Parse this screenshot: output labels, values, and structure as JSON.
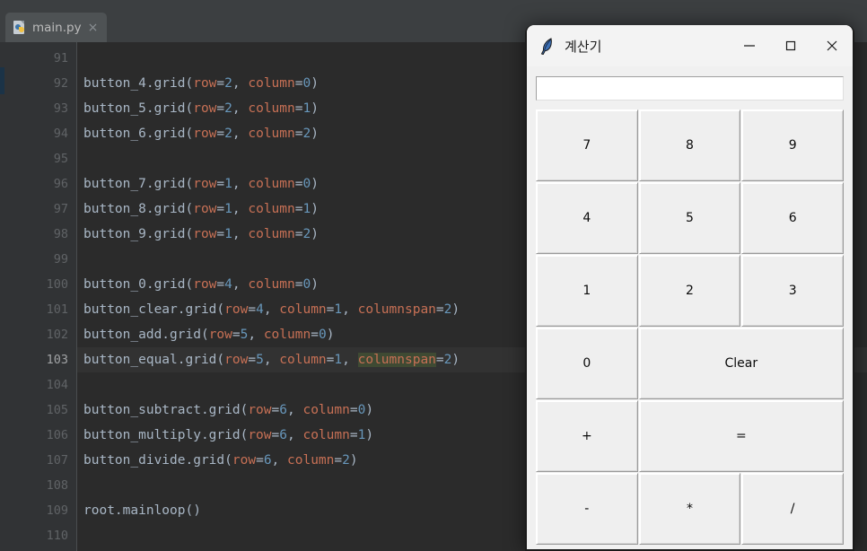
{
  "ide": {
    "tab": {
      "icon": "python-file-icon",
      "label": "main.py",
      "close": "×"
    },
    "editor": {
      "current_line": 103,
      "highlighted_identifier": "columnspan",
      "lines": [
        {
          "no": "91",
          "segments": []
        },
        {
          "no": "92",
          "segments": [
            {
              "t": "button_4.grid(",
              "c": "plain"
            },
            {
              "t": "row",
              "c": "kw"
            },
            {
              "t": "=",
              "c": "plain"
            },
            {
              "t": "2",
              "c": "num"
            },
            {
              "t": ", ",
              "c": "plain"
            },
            {
              "t": "column",
              "c": "kw"
            },
            {
              "t": "=",
              "c": "plain"
            },
            {
              "t": "0",
              "c": "num"
            },
            {
              "t": ")",
              "c": "plain"
            }
          ]
        },
        {
          "no": "93",
          "segments": [
            {
              "t": "button_5.grid(",
              "c": "plain"
            },
            {
              "t": "row",
              "c": "kw"
            },
            {
              "t": "=",
              "c": "plain"
            },
            {
              "t": "2",
              "c": "num"
            },
            {
              "t": ", ",
              "c": "plain"
            },
            {
              "t": "column",
              "c": "kw"
            },
            {
              "t": "=",
              "c": "plain"
            },
            {
              "t": "1",
              "c": "num"
            },
            {
              "t": ")",
              "c": "plain"
            }
          ]
        },
        {
          "no": "94",
          "segments": [
            {
              "t": "button_6.grid(",
              "c": "plain"
            },
            {
              "t": "row",
              "c": "kw"
            },
            {
              "t": "=",
              "c": "plain"
            },
            {
              "t": "2",
              "c": "num"
            },
            {
              "t": ", ",
              "c": "plain"
            },
            {
              "t": "column",
              "c": "kw"
            },
            {
              "t": "=",
              "c": "plain"
            },
            {
              "t": "2",
              "c": "num"
            },
            {
              "t": ")",
              "c": "plain"
            }
          ]
        },
        {
          "no": "95",
          "segments": []
        },
        {
          "no": "96",
          "segments": [
            {
              "t": "button_7.grid(",
              "c": "plain"
            },
            {
              "t": "row",
              "c": "kw"
            },
            {
              "t": "=",
              "c": "plain"
            },
            {
              "t": "1",
              "c": "num"
            },
            {
              "t": ", ",
              "c": "plain"
            },
            {
              "t": "column",
              "c": "kw"
            },
            {
              "t": "=",
              "c": "plain"
            },
            {
              "t": "0",
              "c": "num"
            },
            {
              "t": ")",
              "c": "plain"
            }
          ]
        },
        {
          "no": "97",
          "segments": [
            {
              "t": "button_8.grid(",
              "c": "plain"
            },
            {
              "t": "row",
              "c": "kw"
            },
            {
              "t": "=",
              "c": "plain"
            },
            {
              "t": "1",
              "c": "num"
            },
            {
              "t": ", ",
              "c": "plain"
            },
            {
              "t": "column",
              "c": "kw"
            },
            {
              "t": "=",
              "c": "plain"
            },
            {
              "t": "1",
              "c": "num"
            },
            {
              "t": ")",
              "c": "plain"
            }
          ]
        },
        {
          "no": "98",
          "segments": [
            {
              "t": "button_9.grid(",
              "c": "plain"
            },
            {
              "t": "row",
              "c": "kw"
            },
            {
              "t": "=",
              "c": "plain"
            },
            {
              "t": "1",
              "c": "num"
            },
            {
              "t": ", ",
              "c": "plain"
            },
            {
              "t": "column",
              "c": "kw"
            },
            {
              "t": "=",
              "c": "plain"
            },
            {
              "t": "2",
              "c": "num"
            },
            {
              "t": ")",
              "c": "plain"
            }
          ]
        },
        {
          "no": "99",
          "segments": []
        },
        {
          "no": "100",
          "segments": [
            {
              "t": "button_0.grid(",
              "c": "plain"
            },
            {
              "t": "row",
              "c": "kw"
            },
            {
              "t": "=",
              "c": "plain"
            },
            {
              "t": "4",
              "c": "num"
            },
            {
              "t": ", ",
              "c": "plain"
            },
            {
              "t": "column",
              "c": "kw"
            },
            {
              "t": "=",
              "c": "plain"
            },
            {
              "t": "0",
              "c": "num"
            },
            {
              "t": ")",
              "c": "plain"
            }
          ]
        },
        {
          "no": "101",
          "segments": [
            {
              "t": "button_clear.grid(",
              "c": "plain"
            },
            {
              "t": "row",
              "c": "kw"
            },
            {
              "t": "=",
              "c": "plain"
            },
            {
              "t": "4",
              "c": "num"
            },
            {
              "t": ", ",
              "c": "plain"
            },
            {
              "t": "column",
              "c": "kw"
            },
            {
              "t": "=",
              "c": "plain"
            },
            {
              "t": "1",
              "c": "num"
            },
            {
              "t": ", ",
              "c": "plain"
            },
            {
              "t": "columnspan",
              "c": "kw"
            },
            {
              "t": "=",
              "c": "plain"
            },
            {
              "t": "2",
              "c": "num"
            },
            {
              "t": ")",
              "c": "plain"
            }
          ]
        },
        {
          "no": "102",
          "segments": [
            {
              "t": "button_add.grid(",
              "c": "plain"
            },
            {
              "t": "row",
              "c": "kw"
            },
            {
              "t": "=",
              "c": "plain"
            },
            {
              "t": "5",
              "c": "num"
            },
            {
              "t": ", ",
              "c": "plain"
            },
            {
              "t": "column",
              "c": "kw"
            },
            {
              "t": "=",
              "c": "plain"
            },
            {
              "t": "0",
              "c": "num"
            },
            {
              "t": ")",
              "c": "plain"
            }
          ]
        },
        {
          "no": "103",
          "current": true,
          "segments": [
            {
              "t": "button_equal.grid(",
              "c": "plain"
            },
            {
              "t": "row",
              "c": "kw"
            },
            {
              "t": "=",
              "c": "plain"
            },
            {
              "t": "5",
              "c": "num"
            },
            {
              "t": ", ",
              "c": "plain"
            },
            {
              "t": "column",
              "c": "kw"
            },
            {
              "t": "=",
              "c": "plain"
            },
            {
              "t": "1",
              "c": "num"
            },
            {
              "t": ", ",
              "c": "plain"
            },
            {
              "t": "columnspan",
              "c": "hl"
            },
            {
              "t": "=",
              "c": "plain"
            },
            {
              "t": "2",
              "c": "num"
            },
            {
              "t": ")",
              "c": "plain"
            }
          ]
        },
        {
          "no": "104",
          "segments": []
        },
        {
          "no": "105",
          "segments": [
            {
              "t": "button_subtract.grid(",
              "c": "plain"
            },
            {
              "t": "row",
              "c": "kw"
            },
            {
              "t": "=",
              "c": "plain"
            },
            {
              "t": "6",
              "c": "num"
            },
            {
              "t": ", ",
              "c": "plain"
            },
            {
              "t": "column",
              "c": "kw"
            },
            {
              "t": "=",
              "c": "plain"
            },
            {
              "t": "0",
              "c": "num"
            },
            {
              "t": ")",
              "c": "plain"
            }
          ]
        },
        {
          "no": "106",
          "segments": [
            {
              "t": "button_multiply.grid(",
              "c": "plain"
            },
            {
              "t": "row",
              "c": "kw"
            },
            {
              "t": "=",
              "c": "plain"
            },
            {
              "t": "6",
              "c": "num"
            },
            {
              "t": ", ",
              "c": "plain"
            },
            {
              "t": "column",
              "c": "kw"
            },
            {
              "t": "=",
              "c": "plain"
            },
            {
              "t": "1",
              "c": "num"
            },
            {
              "t": ")",
              "c": "plain"
            }
          ]
        },
        {
          "no": "107",
          "segments": [
            {
              "t": "button_divide.grid(",
              "c": "plain"
            },
            {
              "t": "row",
              "c": "kw"
            },
            {
              "t": "=",
              "c": "plain"
            },
            {
              "t": "6",
              "c": "num"
            },
            {
              "t": ", ",
              "c": "plain"
            },
            {
              "t": "column",
              "c": "kw"
            },
            {
              "t": "=",
              "c": "plain"
            },
            {
              "t": "2",
              "c": "num"
            },
            {
              "t": ")",
              "c": "plain"
            }
          ]
        },
        {
          "no": "108",
          "segments": []
        },
        {
          "no": "109",
          "segments": [
            {
              "t": "root.mainloop()",
              "c": "plain"
            }
          ]
        },
        {
          "no": "110",
          "segments": []
        }
      ]
    },
    "colors": {
      "background": "#2b2b2b",
      "gutter": "#313335",
      "tabbar": "#3c3f41",
      "text": "#a9b7c6",
      "keyword_arg": "#c77055",
      "number": "#6897bb",
      "lineno": "#606366",
      "identifier_highlight": "#3f4a33"
    }
  },
  "calculator": {
    "titlebar": {
      "icon": "feather-icon",
      "title": "계산기",
      "minimize": "—",
      "maximize": "□",
      "close": "✕"
    },
    "display": {
      "value": "",
      "placeholder": ""
    },
    "buttons": [
      {
        "label": "7",
        "name": "button-7",
        "span": 1
      },
      {
        "label": "8",
        "name": "button-8",
        "span": 1
      },
      {
        "label": "9",
        "name": "button-9",
        "span": 1
      },
      {
        "label": "4",
        "name": "button-4",
        "span": 1
      },
      {
        "label": "5",
        "name": "button-5",
        "span": 1
      },
      {
        "label": "6",
        "name": "button-6",
        "span": 1
      },
      {
        "label": "1",
        "name": "button-1",
        "span": 1
      },
      {
        "label": "2",
        "name": "button-2",
        "span": 1
      },
      {
        "label": "3",
        "name": "button-3",
        "span": 1
      },
      {
        "label": "0",
        "name": "button-0",
        "span": 1
      },
      {
        "label": "Clear",
        "name": "button-clear",
        "span": 2
      },
      {
        "label": "+",
        "name": "button-add",
        "span": 1
      },
      {
        "label": "=",
        "name": "button-equal",
        "span": 2
      },
      {
        "label": "-",
        "name": "button-subtract",
        "span": 1
      },
      {
        "label": "*",
        "name": "button-multiply",
        "span": 1
      },
      {
        "label": "/",
        "name": "button-divide",
        "span": 1
      }
    ],
    "colors": {
      "window_bg": "#f0f0f0",
      "button_bg": "#efefef",
      "titlebar_bg": "#f3f3f3",
      "entry_bg": "#ffffff"
    }
  }
}
